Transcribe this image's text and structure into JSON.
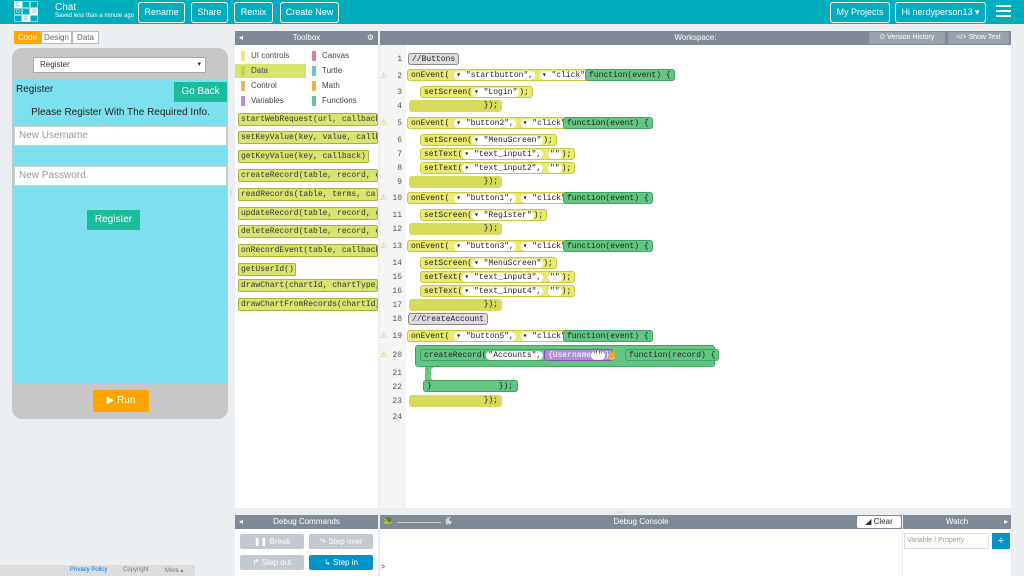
{
  "header": {
    "logo_letters": [
      "C",
      "O",
      "D",
      "E"
    ],
    "app_name": "Chat",
    "saved_status": "Saved less than a minute ago",
    "buttons": [
      "Rename",
      "Share",
      "Remix",
      "Create New"
    ],
    "my_projects": "My Projects",
    "user": "Hi nerdyperson13 ▾"
  },
  "left": {
    "tabs": [
      "Code",
      "Design",
      "Data"
    ],
    "screen_select": "Register",
    "app": {
      "title": "Register",
      "go_back": "Go Back",
      "message": "Please Register With The Required Info.",
      "username_placeholder": "New Username",
      "password_placeholder": "New Password",
      "register_button": "Register"
    },
    "run": "Run"
  },
  "footer": {
    "privacy": "Privacy Policy",
    "copyright": "Copyright",
    "more": "More ▴"
  },
  "toolbox": {
    "title": "Toolbox",
    "categories": [
      {
        "label": "UI controls",
        "color": "#f7e37a"
      },
      {
        "label": "Canvas",
        "color": "#e77b8c"
      },
      {
        "label": "Data",
        "color": "#d9e46f"
      },
      {
        "label": "Turtle",
        "color": "#6bc1d8"
      },
      {
        "label": "Control",
        "color": "#e8b66b"
      },
      {
        "label": "Math",
        "color": "#f2b04a"
      },
      {
        "label": "Variables",
        "color": "#b08cd9"
      },
      {
        "label": "Functions",
        "color": "#68c590"
      }
    ],
    "blocks": [
      "startWebRequest(url, callback)",
      "setKeyValue(key, value, callback)",
      "getKeyValue(key, callback)",
      "createRecord(table, record, callback)",
      "readRecords(table, terms, callback)",
      "updateRecord(table, record, callback)",
      "deleteRecord(table, record, callback)",
      "onRecordEvent(table, callback)",
      "getUserId()",
      "drawChart(chartId, chartType, ...)",
      "drawChartFromRecords(chartId, ...)"
    ]
  },
  "workspace": {
    "title": "Workspace:",
    "version_history": "Version History",
    "show_text": "Show Text",
    "line_numbers": [
      "1",
      "2",
      "3",
      "4",
      "5",
      "6",
      "7",
      "8",
      "9",
      "10",
      "11",
      "12",
      "13",
      "14",
      "15",
      "16",
      "17",
      "18",
      "19",
      "20",
      "21",
      "22",
      "23",
      "24"
    ],
    "warn_lines": [
      "⚠",
      "⚠",
      "⚠",
      "⚠",
      "⚠",
      "⚠"
    ],
    "code": {
      "c1": "//Buttons",
      "c2": "//CreateAccount",
      "onEvent": "onEvent(",
      "setScreen": "setScreen(",
      "setText": "setText(",
      "createRecord": "createRecord(",
      "click": "▾ \"click\",",
      "fn_event": "function(event)",
      "fn_record": "function(record)",
      "brace": "{",
      "close_paren": "});",
      "close_brace": "}",
      "close_semi": ");",
      "id_startbutton": "▾ \"startbutton\",",
      "id_button2": "▾ \"button2\",",
      "id_button1": "▾ \"button1\",",
      "id_button3": "▾ \"button3\",",
      "id_button5": "▾ \"button5\",",
      "scr_login": "▾ \"Login\"",
      "scr_menu": "▾ \"MenuScreen\"",
      "scr_register": "▾ \"Register\"",
      "ti1": "▾ \"text_input1\",",
      "ti2": "▾ \"text_input2\",",
      "ti3": "▾ \"text_input3\",",
      "ti4": "▾ \"text_input4\",",
      "empty": "\"\"",
      "accounts": "\"Accounts\",",
      "username_key": "{Username",
      "quote": "\"\"",
      "close_obj": "}"
    }
  },
  "debug": {
    "commands": "Debug Commands",
    "console": "Debug Console",
    "clear": "Clear",
    "watch": "Watch",
    "watch_placeholder": "Variable / Property",
    "break": "Break",
    "step_over": "Step over",
    "step_out": "Step out",
    "step_in": "Step in",
    "prompt": ">",
    "add": "+"
  }
}
